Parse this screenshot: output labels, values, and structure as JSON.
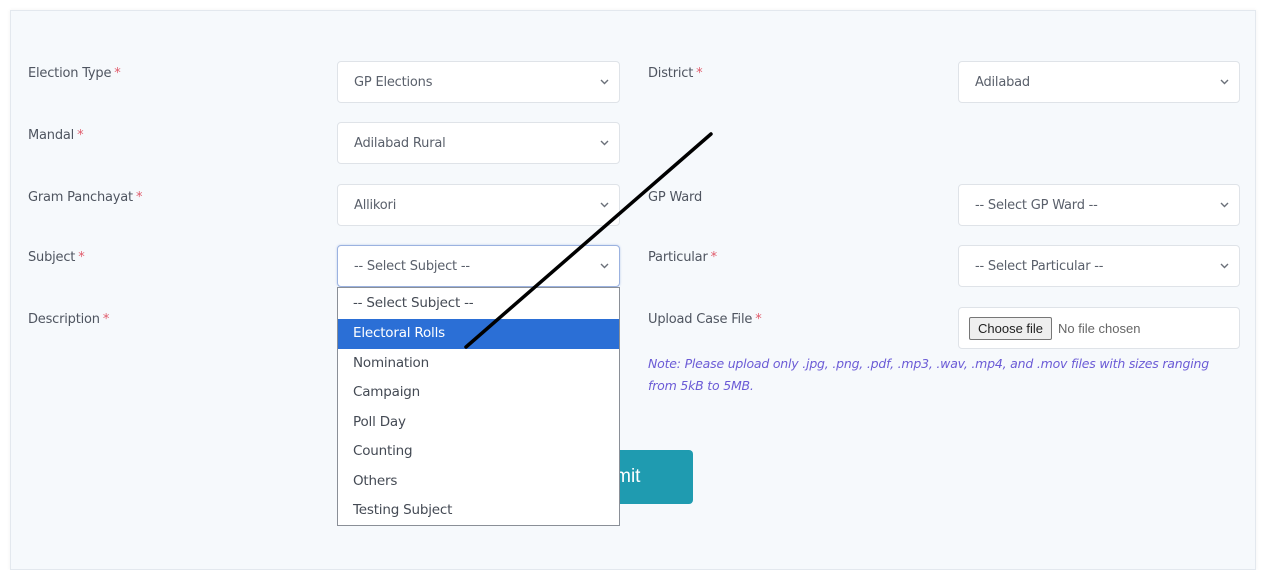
{
  "form": {
    "election_type": {
      "label": "Election Type",
      "required": "*",
      "value": "GP Elections"
    },
    "district": {
      "label": "District",
      "required": "*",
      "value": "Adilabad"
    },
    "mandal": {
      "label": "Mandal",
      "required": "*",
      "value": "Adilabad Rural"
    },
    "gram_panchayat": {
      "label": "Gram Panchayat",
      "required": "*",
      "value": "Allikori"
    },
    "gp_ward": {
      "label": "GP Ward",
      "value": "-- Select GP Ward --"
    },
    "subject": {
      "label": "Subject",
      "required": "*",
      "value": "-- Select Subject --",
      "options": [
        "-- Select Subject --",
        "Electoral Rolls",
        "Nomination",
        "Campaign",
        "Poll Day",
        "Counting",
        "Others",
        "Testing Subject"
      ],
      "highlighted": "Electoral Rolls"
    },
    "particular": {
      "label": "Particular",
      "required": "*",
      "value": "-- Select Particular --"
    },
    "description": {
      "label": "Description",
      "required": "*"
    },
    "upload": {
      "label": "Upload Case File",
      "required": "*",
      "button_label": "Choose file",
      "status": "No file chosen",
      "note": "Note: Please upload only .jpg, .png, .pdf, .mp3, .wav, .mp4, and .mov files with sizes ranging from 5kB to 5MB."
    },
    "submit_label": "ubmit"
  },
  "icons": {
    "select_caret": "chevron-down-icon"
  },
  "colors": {
    "required": "#e05a6a",
    "highlight": "#2b6fd6",
    "submit": "#1f9bb0",
    "note": "#6b5bd6"
  }
}
